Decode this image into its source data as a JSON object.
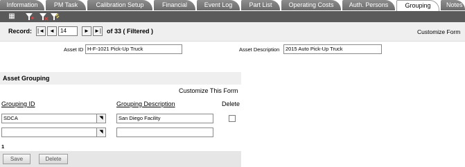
{
  "tabs": [
    {
      "label": "Information"
    },
    {
      "label": "PM Task"
    },
    {
      "label": "Calibration Setup"
    },
    {
      "label": "Financial"
    },
    {
      "label": "Event Log"
    },
    {
      "label": "Part List"
    },
    {
      "label": "Operating Costs"
    },
    {
      "label": "Auth. Persons"
    },
    {
      "label": "Grouping"
    },
    {
      "label": "Notes"
    }
  ],
  "active_tab": "Grouping",
  "toolbar": {
    "icons": [
      "grid-icon",
      "filter-icon",
      "filter-clear-icon",
      "filter-apply-icon"
    ]
  },
  "record": {
    "label": "Record:",
    "current": "14",
    "total_text": "of 33 ( Filtered )",
    "first": "|◄",
    "prev": "◄",
    "next": "►",
    "last": "►|",
    "customize_label": "Customize Form"
  },
  "asset": {
    "id_label": "Asset ID",
    "id_value": "H-F-1021 Pick-Up Truck",
    "desc_label": "Asset Description",
    "desc_value": "2015 Auto Pick-Up Truck"
  },
  "grouping": {
    "title": "Asset Grouping",
    "customize_label": "Customize This Form",
    "headers": {
      "id": "Grouping ID",
      "description": "Grouping Description",
      "delete": "Delete"
    },
    "rows": [
      {
        "id": "SDCA",
        "description": "San Diego Facility"
      },
      {
        "id": "",
        "description": ""
      }
    ],
    "count": "1",
    "save_label": "Save",
    "delete_label": "Delete"
  }
}
